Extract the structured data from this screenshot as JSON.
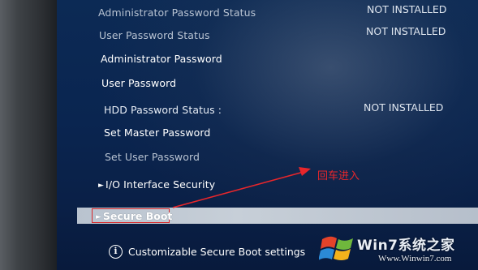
{
  "settings": [
    {
      "label": "Administrator Password Status",
      "value": "NOT INSTALLED"
    },
    {
      "label": "User Password Status",
      "value": "NOT INSTALLED"
    },
    {
      "label": "Administrator Password"
    },
    {
      "label": "User Password"
    },
    {
      "label": "HDD Password Status  :",
      "value": "NOT INSTALLED"
    },
    {
      "label": "Set Master Password"
    },
    {
      "label": "Set User Password"
    },
    {
      "label": "I/O Interface Security"
    },
    {
      "label": "Secure Boot"
    }
  ],
  "info": {
    "icon": "info-icon",
    "text": "Customizable Secure Boot settings"
  },
  "annotation": {
    "text": "回车进入",
    "color": "#e8262b"
  },
  "watermark": {
    "brand": "Win7系统之家",
    "url": "Www.Winwin7.com"
  },
  "colors": {
    "screen_bg": "#0a2550",
    "highlight": "#c0c9d4",
    "annotation_red": "#e8262b"
  }
}
